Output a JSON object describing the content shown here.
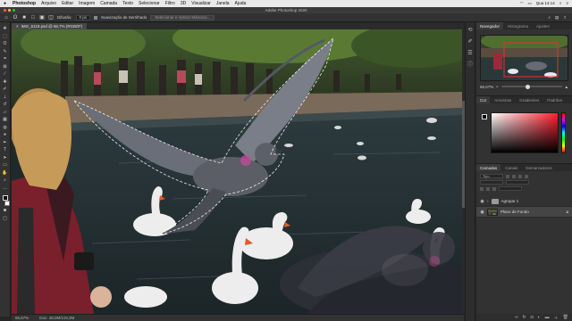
{
  "menubar": {
    "app_name": "Photoshop",
    "items": [
      "Arquivo",
      "Editar",
      "Imagem",
      "Camada",
      "Texto",
      "Selecionar",
      "Filtro",
      "3D",
      "Visualizar",
      "Janela",
      "Ajuda"
    ],
    "clock": "Qua 14:14"
  },
  "window": {
    "title": "Adobe Photoshop 2020"
  },
  "options": {
    "tolerance_label": "Difusão:",
    "tolerance_value": "0 px",
    "antialias_label": "Suavização de Serrilhado",
    "select_mask_button": "Selecionar e Aplicar Máscara..."
  },
  "document": {
    "tab_title": "IMG_5118.psd @ 66,7% (RGB/8*)",
    "close_glyph": "×"
  },
  "status": {
    "zoom": "66,67%",
    "doc_size": "Doc: 48,0M/119,3M"
  },
  "panels": {
    "top_tabs": [
      "Navegador",
      "Histograma",
      "Ajustes"
    ],
    "zoom_value": "66,67%",
    "color_tabs": [
      "Cor",
      "Amostras",
      "Gradientes",
      "Padrões"
    ],
    "layer_tabs": [
      "Camadas",
      "Canais",
      "Demarcadores"
    ],
    "layer_kind": "Tipo",
    "layers": [
      {
        "name": "Agrupar 1",
        "kind": "group"
      },
      {
        "name": "Plano de Fundo",
        "kind": "pixel"
      }
    ]
  },
  "colors": {
    "foreground": "#000000",
    "background": "#ffffff",
    "picker_hue": "#ff1e2e"
  }
}
